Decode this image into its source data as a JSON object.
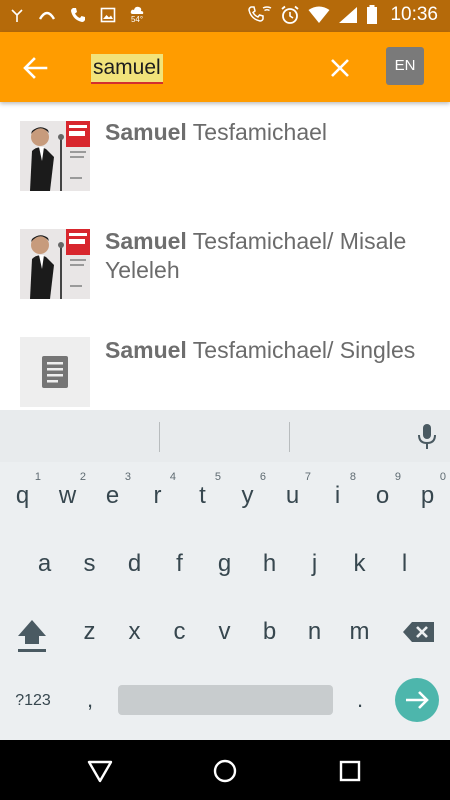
{
  "status_bar": {
    "time": "10:36",
    "weather_temp": "54°",
    "icons": [
      "signal-antenna-icon",
      "chevron-icon",
      "phone-icon",
      "image-icon",
      "weather-icon",
      "wifi-calling-icon",
      "alarm-icon",
      "wifi-icon",
      "battery-icon"
    ]
  },
  "app_bar": {
    "background_color": "#FF9C00",
    "search_value": "samuel",
    "back_icon": "arrow-left-icon",
    "clear_icon": "close-icon",
    "language_label": "EN"
  },
  "results": [
    {
      "bold": "Samuel",
      "rest": " Tesfamichael",
      "thumb": "photo"
    },
    {
      "bold": "Samuel",
      "rest": " Tesfamichael/ Misale Yeleleh",
      "thumb": "photo"
    },
    {
      "bold": "Samuel",
      "rest": " Tesfamichael/ Singles",
      "thumb": "document-icon"
    }
  ],
  "keyboard": {
    "row1": [
      {
        "k": "q",
        "h": "1"
      },
      {
        "k": "w",
        "h": "2"
      },
      {
        "k": "e",
        "h": "3"
      },
      {
        "k": "r",
        "h": "4"
      },
      {
        "k": "t",
        "h": "5"
      },
      {
        "k": "y",
        "h": "6"
      },
      {
        "k": "u",
        "h": "7"
      },
      {
        "k": "i",
        "h": "8"
      },
      {
        "k": "o",
        "h": "9"
      },
      {
        "k": "p",
        "h": "0"
      }
    ],
    "row2": [
      "a",
      "s",
      "d",
      "f",
      "g",
      "h",
      "j",
      "k",
      "l"
    ],
    "row3": [
      "z",
      "x",
      "c",
      "v",
      "b",
      "n",
      "m"
    ],
    "symbols_label": "?123",
    "comma": ",",
    "period": ".",
    "enter_color": "#4DB6AC"
  },
  "nav_bar": {
    "buttons": [
      "back-triangle-icon",
      "home-circle-icon",
      "recents-square-icon"
    ]
  }
}
